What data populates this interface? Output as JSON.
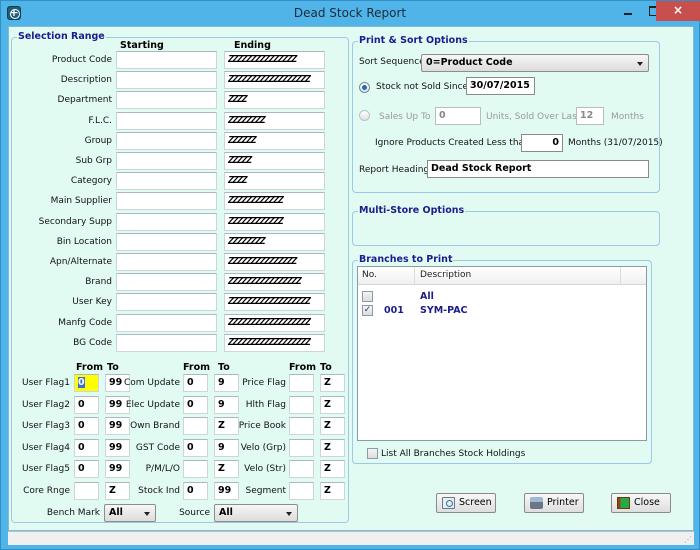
{
  "window": {
    "title": "Dead Stock Report",
    "app_icon": "app-logo-icon",
    "controls": {
      "minimize": "minimize-icon",
      "maximize": "maximize-icon",
      "close": "×"
    }
  },
  "selection_range": {
    "title": "Selection Range",
    "title_mnemonic": "R",
    "col_starting": "Starting",
    "col_ending": "Ending",
    "rows": [
      {
        "label": "Product Code",
        "start": "",
        "end": "ZZZZZZZZZZZZZZZ"
      },
      {
        "label": "Description",
        "start": "",
        "end": "ZZZZZZZZZZZZZZZZZZ"
      },
      {
        "label": "Department",
        "start": "",
        "end": "ZZZZ"
      },
      {
        "label": "F.L.C.",
        "start": "",
        "end": "ZZZZZZZZ"
      },
      {
        "label": "Group",
        "start": "",
        "end": "ZZZZZZ"
      },
      {
        "label": "Sub Grp",
        "start": "",
        "end": "ZZZZZ"
      },
      {
        "label": "Category",
        "start": "",
        "end": "ZZZZ"
      },
      {
        "label": "Main Supplier",
        "start": "",
        "end": "ZZZZZZZZZZZZ"
      },
      {
        "label": "Secondary Supp",
        "start": "",
        "end": "ZZZZZZZZZZZZ"
      },
      {
        "label": "Bin Location",
        "start": "",
        "end": "ZZZZZZZZ"
      },
      {
        "label": "Apn/Alternate",
        "start": "",
        "end": "ZZZZZZZZZZZZZZZ"
      },
      {
        "label": "Brand",
        "start": "",
        "end": "ZZZZZZZZZZZZZZZZ"
      },
      {
        "label": "User Key",
        "start": "",
        "end": "ZZZZZZZZZZZZZZZZZZ"
      },
      {
        "label": "Manfg Code",
        "start": "",
        "end": "ZZZZZZZZZZZZZZZZZZ"
      },
      {
        "label": "BG Code",
        "start": "",
        "end": "ZZZZZZZZZZZZZZZZZZ"
      }
    ],
    "flag_headers": {
      "from": "From",
      "to": "To"
    },
    "flags_col1": [
      {
        "label": "User Flag1",
        "from": "0",
        "to": "99"
      },
      {
        "label": "User Flag2",
        "from": "0",
        "to": "99"
      },
      {
        "label": "User Flag3",
        "from": "0",
        "to": "99"
      },
      {
        "label": "User Flag4",
        "from": "0",
        "to": "99"
      },
      {
        "label": "User Flag5",
        "from": "0",
        "to": "99"
      },
      {
        "label": "Core Rnge",
        "from": "",
        "to": "Z"
      }
    ],
    "flags_col2": [
      {
        "label": "Com Update",
        "from": "0",
        "to": "9"
      },
      {
        "label": "Elec Update",
        "from": "0",
        "to": "9"
      },
      {
        "label": "Own Brand",
        "from": "",
        "to": "Z"
      },
      {
        "label": "GST Code",
        "from": "0",
        "to": "9"
      },
      {
        "label": "P/M/L/O",
        "from": "",
        "to": "Z"
      },
      {
        "label": "Stock Ind",
        "from": "0",
        "to": "99"
      }
    ],
    "flags_col3": [
      {
        "label": "Price Flag",
        "from": "",
        "to": "Z"
      },
      {
        "label": "Hlth Flag",
        "from": "",
        "to": "Z"
      },
      {
        "label": "Price Book",
        "from": "",
        "to": "Z"
      },
      {
        "label": "Velo (Grp)",
        "from": "",
        "to": "Z"
      },
      {
        "label": "Velo (Str)",
        "from": "",
        "to": "Z"
      },
      {
        "label": "Segment",
        "from": "",
        "to": "Z"
      }
    ],
    "bench_mark": {
      "label": "Bench Mark",
      "value": "All"
    },
    "source": {
      "label": "Source",
      "value": "All"
    }
  },
  "print_sort": {
    "title": "Print & Sort Options",
    "title_mnemonic": "P",
    "sort_sequence": {
      "label": "Sort Sequence",
      "value": "0=Product Code"
    },
    "stock_not_sold": {
      "label": "Stock not Sold Since",
      "value": "30/07/2015",
      "selected": true
    },
    "sales_up_to": {
      "label": "Sales Up To",
      "value": "0",
      "units_label": "Units, Sold Over Last",
      "months_value": "12",
      "months_label": "Months",
      "selected": false
    },
    "ignore_products": {
      "label": "Ignore Products Created Less than",
      "value": "0",
      "suffix": "Months (31/07/2015)"
    },
    "report_heading": {
      "label": "Report Heading",
      "value": "Dead Stock Report"
    }
  },
  "multi_store": {
    "title": "Multi-Store Options"
  },
  "branches": {
    "title": "Branches to Print",
    "columns": [
      "No.",
      "Description"
    ],
    "rows": [
      {
        "checked": false,
        "no": "",
        "description": "All"
      },
      {
        "checked": true,
        "no": "001",
        "description": "SYM-PAC"
      }
    ],
    "list_all_label": "List All Branches Stock Holdings",
    "list_all_checked": false
  },
  "buttons": {
    "screen": {
      "label": "Screen",
      "mnemonic": "S",
      "icon": "screen-preview-icon"
    },
    "printer": {
      "label": "Printer",
      "mnemonic": "P",
      "icon": "printer-icon"
    },
    "close": {
      "label": "Close",
      "mnemonic": "C",
      "icon": "close-door-icon"
    }
  }
}
